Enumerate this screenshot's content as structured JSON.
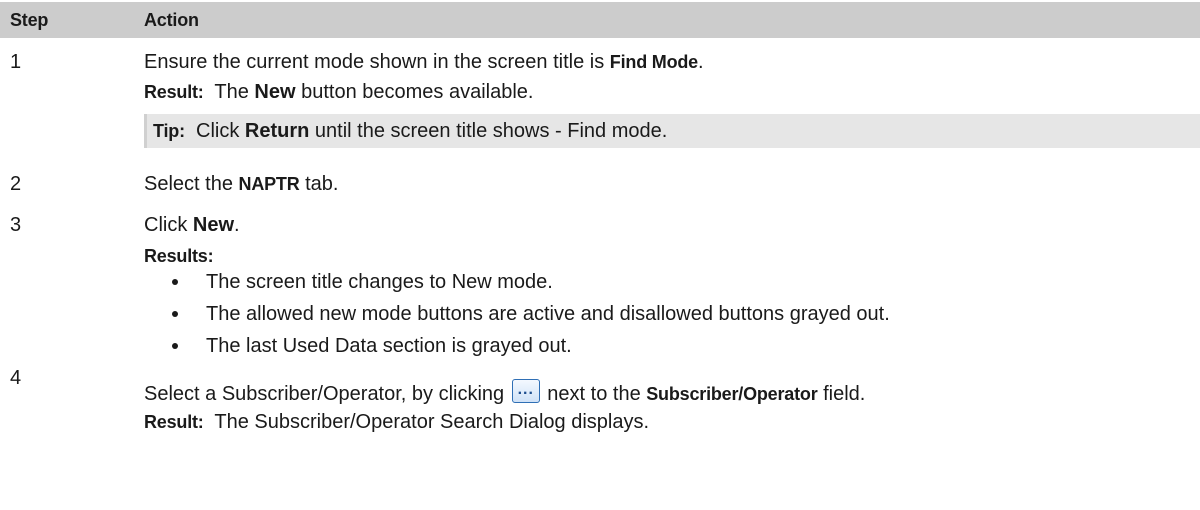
{
  "header": {
    "step": "Step",
    "action": "Action"
  },
  "steps": [
    {
      "number": "1",
      "line_pre": "Ensure the current mode shown in the screen title is ",
      "line_bold": "Find Mode",
      "line_post": ".",
      "result_label": "Result:",
      "result_pre": "The ",
      "result_bold": "New",
      "result_post": " button becomes available.",
      "tip_label": "Tip:",
      "tip_pre": "Click ",
      "tip_bold": "Return",
      "tip_post": " until the screen title shows - Find mode."
    },
    {
      "number": "2",
      "line_pre": "Select the ",
      "line_bold": "NAPTR",
      "line_post": " tab."
    },
    {
      "number": "3",
      "line_pre": "Click ",
      "line_bold": "New",
      "line_post": ".",
      "results_label": "Results:",
      "bullets": [
        "The screen title changes to New mode.",
        "The allowed new mode buttons are active and disallowed buttons grayed out.",
        "The last Used Data section is grayed out."
      ]
    },
    {
      "number": "4",
      "line_pre": "Select a Subscriber/Operator, by clicking ",
      "button_icon": "ellipsis-button-icon",
      "line_mid": " next to the ",
      "line_bold": "Subscriber/Operator",
      "line_post": " field.",
      "result_label": "Result:",
      "result_text": "The Subscriber/Operator Search Dialog displays."
    }
  ]
}
